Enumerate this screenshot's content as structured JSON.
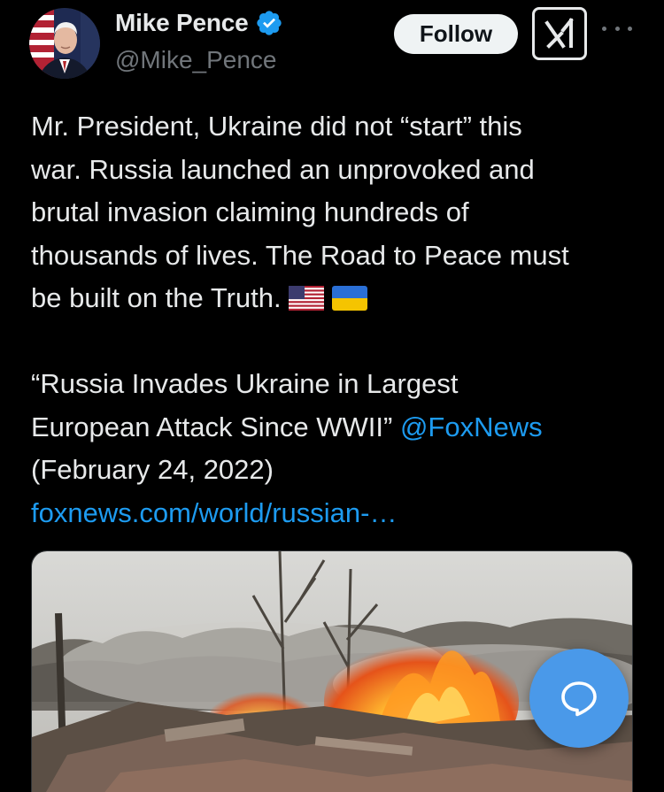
{
  "author": {
    "display_name": "Mike Pence",
    "handle": "@Mike_Pence",
    "verified": true,
    "avatar_icon": "profile-photo"
  },
  "actions": {
    "follow_label": "Follow",
    "grok_icon": "grok-icon",
    "more_icon": "more-dots-icon"
  },
  "tweet": {
    "lines": [
      "Mr. President, Ukraine did not “start” this",
      "war. Russia launched an unprovoked and",
      "brutal invasion claiming hundreds of",
      "thousands of lives. The Road to Peace must"
    ],
    "last_line": "be built on the Truth.",
    "emoji": [
      "us-flag-emoji",
      "ukraine-flag-emoji"
    ],
    "quote_line1": "“Russia Invades Ukraine in Largest",
    "quote_line2": "European Attack Since WWII”",
    "mention": "@FoxNews",
    "date": "(February 24, 2022)",
    "url": "foxnews.com/world/russian-…"
  },
  "media": {
    "description_icon": "news-photo-burning-buildings"
  },
  "fab": {
    "icon": "reply-bubble-icon"
  },
  "colors": {
    "background": "#000000",
    "text": "#e7e9ea",
    "muted": "#71767b",
    "link": "#1d9bf0",
    "verified": "#1d9bf0",
    "fab": "#4a99e9",
    "follow_bg": "#eff3f4"
  }
}
